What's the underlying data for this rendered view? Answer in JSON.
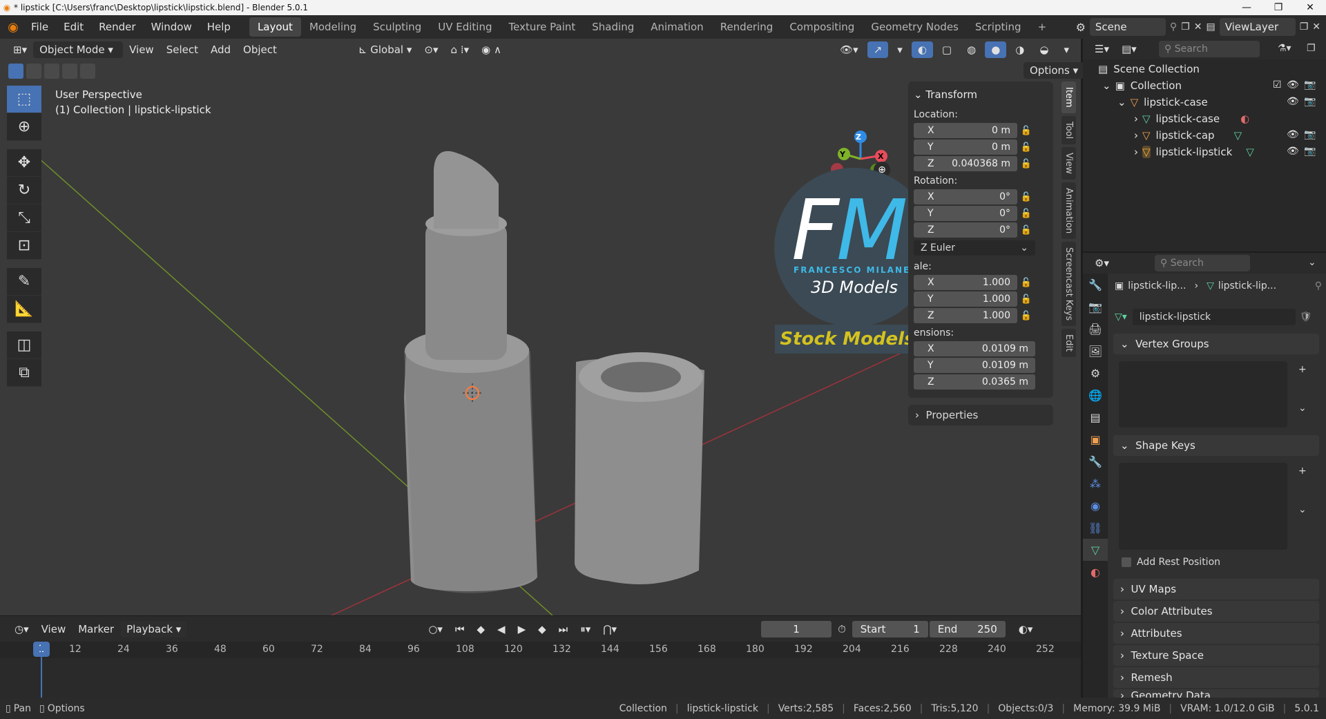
{
  "window": {
    "title": "* lipstick [C:\\Users\\franc\\Desktop\\lipstick\\lipstick.blend] - Blender 5.0.1",
    "controls": [
      "—",
      "❐",
      "✕"
    ]
  },
  "menu": [
    "File",
    "Edit",
    "Render",
    "Window",
    "Help"
  ],
  "workspaces": [
    "Layout",
    "Modeling",
    "Sculpting",
    "UV Editing",
    "Texture Paint",
    "Shading",
    "Animation",
    "Rendering",
    "Compositing",
    "Geometry Nodes",
    "Scripting"
  ],
  "active_workspace": "Layout",
  "scene": {
    "name": "Scene",
    "view_layer": "ViewLayer"
  },
  "viewport_header": {
    "mode": "Object Mode",
    "menus": [
      "View",
      "Select",
      "Add",
      "Object"
    ],
    "orientation": "Global",
    "options_label": "Options"
  },
  "viewport": {
    "perspective": "User Perspective",
    "context": "(1) Collection | lipstick-lipstick",
    "gizmo_axes": [
      "Z",
      "Y",
      "X"
    ]
  },
  "transform_panel": {
    "title": "Transform",
    "location_label": "Location:",
    "location": {
      "x": "0 m",
      "y": "0 m",
      "z": "0.040368 m"
    },
    "rotation_label": "Rotation:",
    "rotation": {
      "x": "0°",
      "y": "0°",
      "z": "0°"
    },
    "rotation_mode": "Z Euler",
    "scale_label": "ale:",
    "scale": {
      "x": "1.000",
      "y": "1.000",
      "z": "1.000"
    },
    "dimensions_label": "ensions:",
    "dimensions": {
      "x": "0.0109 m",
      "y": "0.0109 m",
      "z": "0.0365 m"
    },
    "properties_label": "Properties",
    "axis_labels": [
      "X",
      "Y",
      "Z"
    ]
  },
  "n_tabs": [
    "Item",
    "Tool",
    "View",
    "Animation",
    "Screencast Keys",
    "Edit"
  ],
  "watermark": {
    "f": "F",
    "m": "M",
    "name": "FRANCESCO MILANESE",
    "line2": "3D Models",
    "banner": "Stock Models"
  },
  "timeline": {
    "menus": [
      "View",
      "Marker"
    ],
    "playback": "Playback",
    "current_frame": "1",
    "start_label": "Start",
    "start": "1",
    "end_label": "End",
    "end": "250",
    "ruler": [
      "12",
      "24",
      "36",
      "48",
      "60",
      "72",
      "84",
      "96",
      "108",
      "120",
      "132",
      "144",
      "156",
      "168",
      "180",
      "192",
      "204",
      "216",
      "228",
      "240",
      "252"
    ],
    "marker": "1"
  },
  "outliner": {
    "search_placeholder": "Search",
    "root": "Scene Collection",
    "collection": "Collection",
    "items": [
      {
        "label": "lipstick-case",
        "level": 1
      },
      {
        "label": "lipstick-case",
        "level": 2
      },
      {
        "label": "lipstick-cap",
        "level": 2
      },
      {
        "label": "lipstick-lipstick",
        "level": 2
      }
    ]
  },
  "properties": {
    "search_placeholder": "Search",
    "breadcrumb": [
      "lipstick-lip...",
      "lipstick-lip..."
    ],
    "mesh_name": "lipstick-lipstick",
    "sections": [
      "Vertex Groups",
      "Shape Keys",
      "UV Maps",
      "Color Attributes",
      "Attributes",
      "Texture Space",
      "Remesh",
      "Geometry Data"
    ],
    "add_rest_position": "Add Rest Position"
  },
  "status": {
    "left": [
      "Pan",
      "Options"
    ],
    "collection": "Collection",
    "object": "lipstick-lipstick",
    "verts": "Verts:2,585",
    "faces": "Faces:2,560",
    "tris": "Tris:5,120",
    "objects": "Objects:0/3",
    "memory": "Memory: 39.9 MiB",
    "vram": "VRAM: 1.0/12.0 GiB",
    "version": "5.0.1"
  },
  "colors": {
    "accent": "#4772b3",
    "selected_active": "#ffaf29",
    "axis_x": "#e84c5a",
    "axis_y": "#7fb32a",
    "axis_z": "#2f8ce6",
    "watermark_blue": "#3fb9e8",
    "watermark_yellow": "#d4c21f"
  }
}
